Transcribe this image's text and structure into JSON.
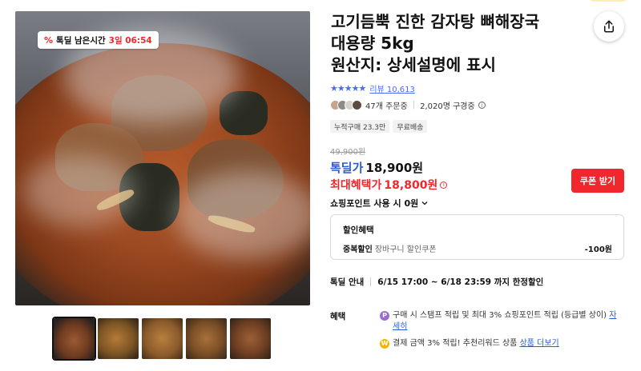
{
  "badge": {
    "pct_symbol": "%",
    "label": "톡딜 남은시간",
    "time": "3일 06:54"
  },
  "product": {
    "title_lines": [
      "고기듬뿍 진한 감자탕 뼈해장국",
      "대용량 5kg",
      "원산지: 상세설명에 표시"
    ]
  },
  "rating": {
    "stars": "★★★★★",
    "review_label": "리뷰 10,613",
    "star_color": "#4a6cf7"
  },
  "buyers": {
    "orders": "47개 주문중",
    "subscribers": "2,020명 구경중"
  },
  "tags": [
    "누적구매 23.3만",
    "무료배송"
  ],
  "price": {
    "original": "49,900원",
    "deal_label": "톡딜가",
    "deal_price": "18,900원",
    "max_label": "최대혜택가",
    "max_price": "18,800원"
  },
  "coupon_button": "쿠폰 받기",
  "points": {
    "label": "쇼핑포인트 사용 시 0원"
  },
  "benefit_box": {
    "title": "할인혜택",
    "item_label": "중복할인",
    "item_sub": "장바구니 할인쿠폰",
    "amount": "-100원"
  },
  "deal_info": {
    "label": "톡딜 안내",
    "period": "6/15 17:00 ~ 6/18 23:59 까지 한정할인"
  },
  "perks": {
    "label": "혜택",
    "items": [
      {
        "icon": "P",
        "text": "구매 시 스탬프 적립 및 최대 3% 쇼핑포인트 적립 (등급별 상이)",
        "link": "자세히"
      },
      {
        "icon": "W",
        "text": "결제 금액 3% 적립! 추천리워드 상품",
        "link": "상품 더보기"
      }
    ]
  },
  "colors": {
    "accent_red": "#f0272c",
    "accent_blue": "#2a5bd7"
  }
}
